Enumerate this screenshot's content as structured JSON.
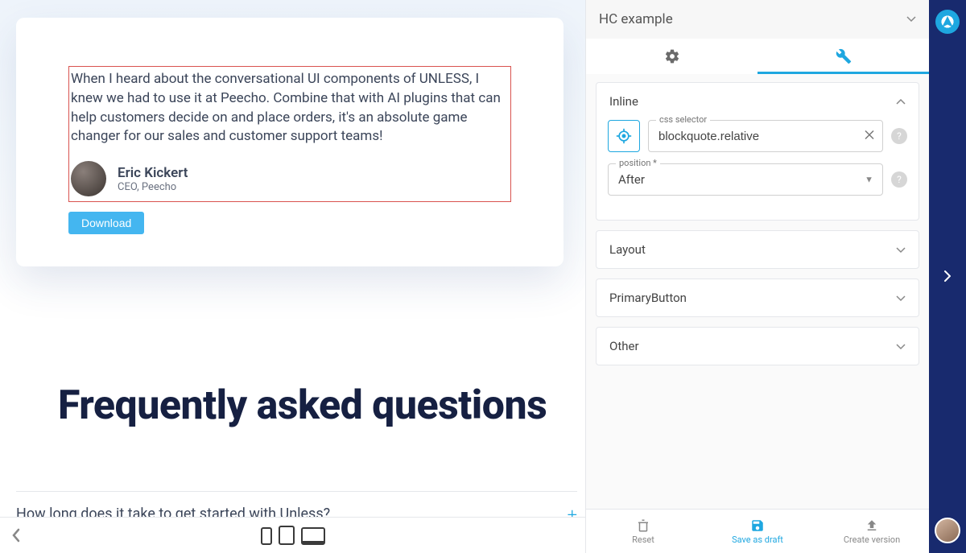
{
  "testimonial": {
    "quote": "When I heard about the conversational UI components of UNLESS, I knew we had to use it at Peecho. Combine that with AI plugins that can help customers decide on and place orders, it's an absolute game changer for our sales and customer support teams!",
    "author_name": "Eric Kickert",
    "author_title": "CEO, Peecho",
    "download_label": "Download"
  },
  "faq": {
    "heading": "Frequently asked questions",
    "first_question": "How long does it take to get started with Unless?",
    "plus": "+"
  },
  "panel": {
    "header_title": "HC example",
    "sections": {
      "inline": {
        "title": "Inline",
        "css_selector_label": "css selector",
        "css_selector_value": "blockquote.relative",
        "position_label": "position *",
        "position_value": "After"
      },
      "layout": {
        "title": "Layout"
      },
      "primary_button": {
        "title": "PrimaryButton"
      },
      "other": {
        "title": "Other"
      }
    }
  },
  "footer": {
    "reset": "Reset",
    "save_draft": "Save as draft",
    "create_version": "Create version"
  },
  "icons": {
    "gear": "gear-icon",
    "wrench": "wrench-icon"
  }
}
